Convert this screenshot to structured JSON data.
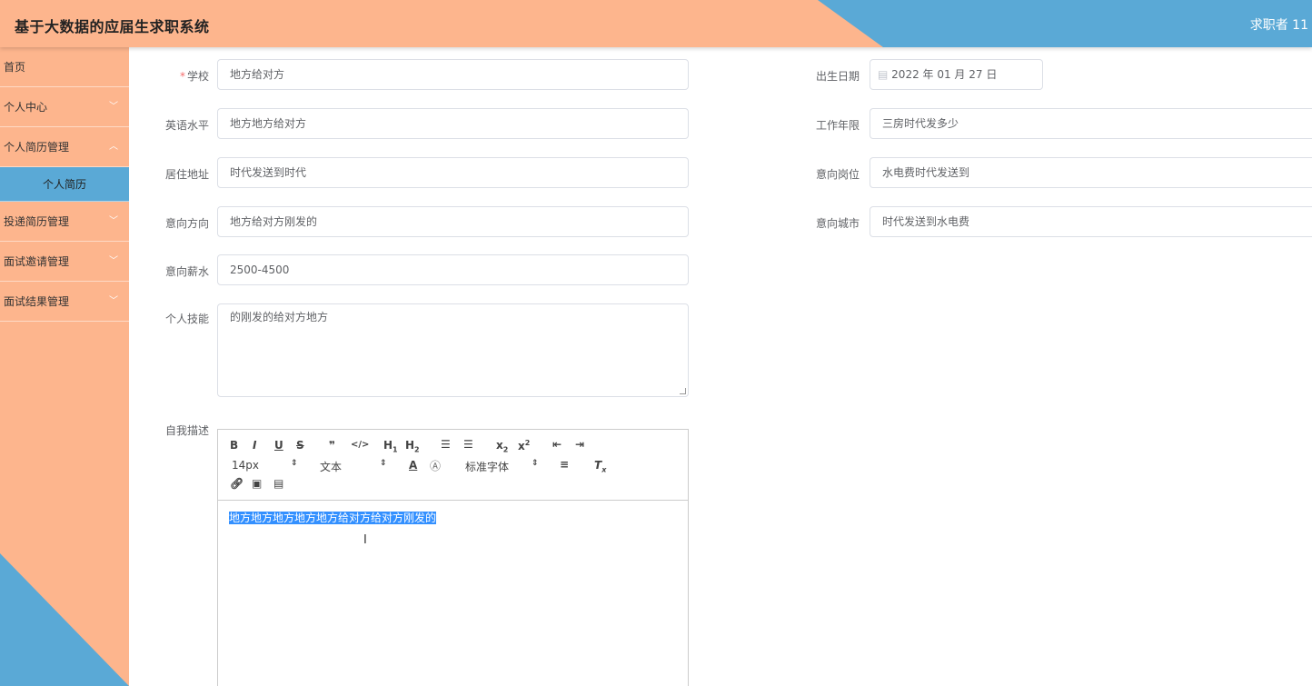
{
  "header": {
    "title": "基于大数据的应届生求职系统",
    "user": "求职者 11"
  },
  "sidebar": {
    "items": [
      {
        "label": "首页"
      },
      {
        "label": "个人中心"
      },
      {
        "label": "个人简历管理"
      },
      {
        "label": "个人简历"
      },
      {
        "label": "投递简历管理"
      },
      {
        "label": "面试邀请管理"
      },
      {
        "label": "面试结果管理"
      }
    ]
  },
  "form": {
    "school": {
      "label": "学校",
      "required_mark": "*",
      "value": "地方给对方"
    },
    "english": {
      "label": "英语水平",
      "value": "地方地方给对方"
    },
    "address": {
      "label": "居住地址",
      "value": "时代发送到时代"
    },
    "direction": {
      "label": "意向方向",
      "value": "地方给对方刚发的"
    },
    "salary": {
      "label": "意向薪水",
      "value": "2500-4500"
    },
    "skills": {
      "label": "个人技能",
      "value": "的刚发的给对方地方"
    },
    "self_desc": {
      "label": "自我描述",
      "value": "地方地方地方地方地方给对方给对方刚发的"
    },
    "birthday": {
      "label": "出生日期",
      "value": "2022 年 01 月 27 日"
    },
    "work_years": {
      "label": "工作年限",
      "value": "三房时代发多少"
    },
    "position": {
      "label": "意向岗位",
      "value": "水电费时代发送到"
    },
    "city": {
      "label": "意向城市",
      "value": "时代发送到水电费"
    }
  },
  "editor": {
    "font_size": "14px",
    "text_type": "文本",
    "font_family": "标准字体",
    "buttons": [
      "B",
      "I",
      "U",
      "S",
      "❞",
      "</>",
      "H1",
      "H2",
      "ol",
      "ul",
      "x₂",
      "x²",
      "outdent",
      "indent",
      "A",
      "bg",
      "align",
      "Tx",
      "link",
      "image",
      "video"
    ]
  },
  "colors": {
    "orange": "#fdb58d",
    "blue": "#5aa9d6",
    "required": "#f56c6c"
  }
}
